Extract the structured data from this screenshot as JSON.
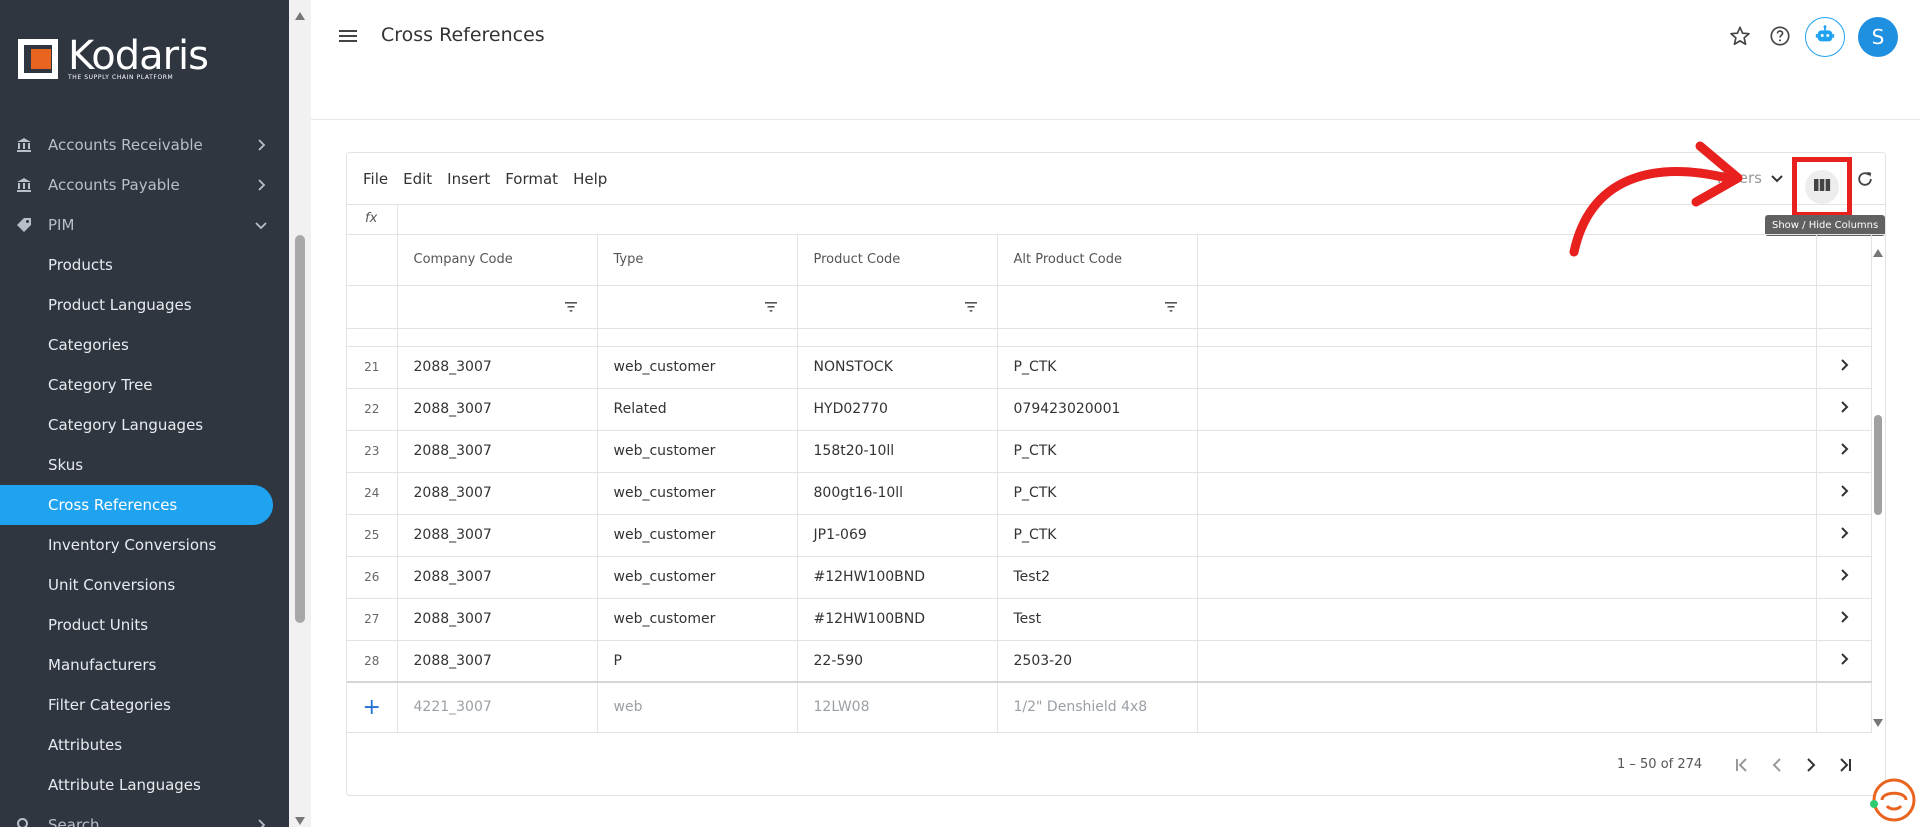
{
  "brand": {
    "name": "Kodaris",
    "tagline": "THE SUPPLY CHAIN PLATFORM",
    "accent": "#1fa2f0",
    "orange": "#e8641f"
  },
  "sidebar": {
    "items": [
      {
        "label": "Accounts Receivable",
        "kind": "top",
        "icon": "bank-icon"
      },
      {
        "label": "Accounts Payable",
        "kind": "top",
        "icon": "bank-icon"
      },
      {
        "label": "PIM",
        "kind": "top-open",
        "icon": "tag-icon"
      },
      {
        "label": "Products",
        "kind": "sub"
      },
      {
        "label": "Product Languages",
        "kind": "sub"
      },
      {
        "label": "Categories",
        "kind": "sub"
      },
      {
        "label": "Category Tree",
        "kind": "sub"
      },
      {
        "label": "Category Languages",
        "kind": "sub"
      },
      {
        "label": "Skus",
        "kind": "sub"
      },
      {
        "label": "Cross References",
        "kind": "sub",
        "active": true
      },
      {
        "label": "Inventory Conversions",
        "kind": "sub"
      },
      {
        "label": "Unit Conversions",
        "kind": "sub"
      },
      {
        "label": "Product Units",
        "kind": "sub"
      },
      {
        "label": "Manufacturers",
        "kind": "sub"
      },
      {
        "label": "Filter Categories",
        "kind": "sub"
      },
      {
        "label": "Attributes",
        "kind": "sub"
      },
      {
        "label": "Attribute Languages",
        "kind": "sub"
      },
      {
        "label": "Search",
        "kind": "top",
        "icon": "search-icon"
      }
    ]
  },
  "header": {
    "title": "Cross References",
    "avatar_letter": "S"
  },
  "grid": {
    "menu": [
      "File",
      "Edit",
      "Insert",
      "Format",
      "Help"
    ],
    "filters_label": "Filters",
    "tooltip": "Show / Hide Columns",
    "fx": "fx",
    "columns": [
      "Company Code",
      "Type",
      "Product Code",
      "Alt Product Code"
    ],
    "rows": [
      {
        "n": "21",
        "company": "2088_3007",
        "type": "web_customer",
        "product": "NONSTOCK",
        "alt": "P_CTK"
      },
      {
        "n": "22",
        "company": "2088_3007",
        "type": "Related",
        "product": "HYD02770",
        "alt": "079423020001"
      },
      {
        "n": "23",
        "company": "2088_3007",
        "type": "web_customer",
        "product": "158t20-10ll",
        "alt": "P_CTK"
      },
      {
        "n": "24",
        "company": "2088_3007",
        "type": "web_customer",
        "product": "800gt16-10ll",
        "alt": "P_CTK"
      },
      {
        "n": "25",
        "company": "2088_3007",
        "type": "web_customer",
        "product": "JP1-069",
        "alt": "P_CTK"
      },
      {
        "n": "26",
        "company": "2088_3007",
        "type": "web_customer",
        "product": "#12HW100BND",
        "alt": "Test2"
      },
      {
        "n": "27",
        "company": "2088_3007",
        "type": "web_customer",
        "product": "#12HW100BND",
        "alt": "Test"
      },
      {
        "n": "28",
        "company": "2088_3007",
        "type": "P",
        "product": "22-590",
        "alt": "2503-20"
      }
    ],
    "new_row": {
      "plus": "+",
      "company": "4221_3007",
      "type": "web",
      "product": "12LW08",
      "alt": "1/2\" Denshield 4x8"
    },
    "pager_text": "1 – 50 of 274"
  }
}
